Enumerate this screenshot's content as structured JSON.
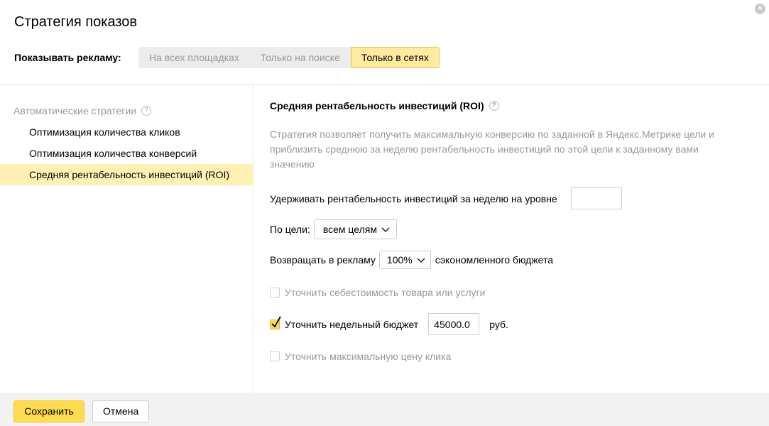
{
  "dialog": {
    "title": "Стратегия показов",
    "close_icon": "×"
  },
  "show_ads": {
    "label": "Показывать рекламу:",
    "options": [
      "На всех площадках",
      "Только на поиске",
      "Только в сетях"
    ],
    "selected": "Только в сетях"
  },
  "sidebar": {
    "heading": "Автоматические стратегии",
    "help_glyph": "?",
    "items": [
      {
        "label": "Оптимизация количества кликов"
      },
      {
        "label": "Оптимизация количества конверсий"
      },
      {
        "label": "Средняя рентабельность инвестиций (ROI)",
        "selected": true
      }
    ]
  },
  "strategy": {
    "title": "Средняя рентабельность инвестиций (ROI)",
    "help_glyph": "?",
    "description": "Стратегия позволяет получить максимальную конверсию по заданной в Яндекс.Метрике цели и приблизить среднюю за неделю рентабельность инвестиций по этой цели к заданному вами значению",
    "roi_label": "Удерживать рентабельность инвестиций за неделю на уровне",
    "roi_value": "",
    "goal_label": "По цели:",
    "goal_value": "всем целям",
    "reserve_label": "Возвращать в рекламу",
    "reserve_value": "100%",
    "reserve_suffix": "сэкономленного бюджета",
    "cost_checkbox": {
      "label": "Уточнить себестоимость товара или услуги",
      "checked": false
    },
    "weekly_budget_checkbox": {
      "label": "Уточнить недельный бюджет",
      "checked": true
    },
    "weekly_budget_value": "45000.0",
    "currency": "руб.",
    "max_click_checkbox": {
      "label": "Уточнить максимальную цену клика",
      "checked": false
    }
  },
  "footer": {
    "save_label": "Сохранить",
    "cancel_label": "Отмена"
  },
  "colors": {
    "accent": "#ffdb4d",
    "selected_bg": "#fff1b3",
    "muted_text": "#999999"
  }
}
